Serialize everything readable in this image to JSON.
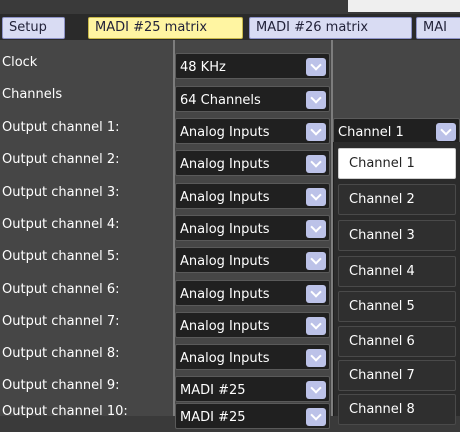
{
  "tabs": [
    {
      "label": "Setup",
      "active": false
    },
    {
      "label": "MADI #25 matrix",
      "active": true
    },
    {
      "label": "MADI #26 matrix",
      "active": false
    },
    {
      "label": "MAI",
      "active": false
    }
  ],
  "settings": {
    "clock": {
      "label": "Clock",
      "value": "48 KHz"
    },
    "channels": {
      "label": "Channels",
      "value": "64 Channels"
    }
  },
  "outputs": [
    {
      "label": "Output channel 1:",
      "source": "Analog Inputs",
      "channel": "Channel 1"
    },
    {
      "label": "Output channel 2:",
      "source": "Analog Inputs"
    },
    {
      "label": "Output channel 3:",
      "source": "Analog Inputs"
    },
    {
      "label": "Output channel 4:",
      "source": "Analog Inputs"
    },
    {
      "label": "Output channel 5:",
      "source": "Analog Inputs"
    },
    {
      "label": "Output channel 6:",
      "source": "Analog Inputs"
    },
    {
      "label": "Output channel 7:",
      "source": "Analog Inputs"
    },
    {
      "label": "Output channel 8:",
      "source": "Analog Inputs"
    },
    {
      "label": "Output channel 9:",
      "source": "MADI #25"
    },
    {
      "label": "Output channel 10:",
      "source": "MADI #25"
    }
  ],
  "channel_dropdown": {
    "options": [
      "Channel 1",
      "Channel 2",
      "Channel 3",
      "Channel 4",
      "Channel 5",
      "Channel 6",
      "Channel 7",
      "Channel 8"
    ],
    "selected_index": 0
  },
  "colors": {
    "active_tab": "#fff5a2",
    "tab": "#d9dcf3",
    "chevron": "#bcc2e8",
    "panel": "#464646"
  },
  "icons": {
    "dropdown": "chevron-down-icon"
  }
}
